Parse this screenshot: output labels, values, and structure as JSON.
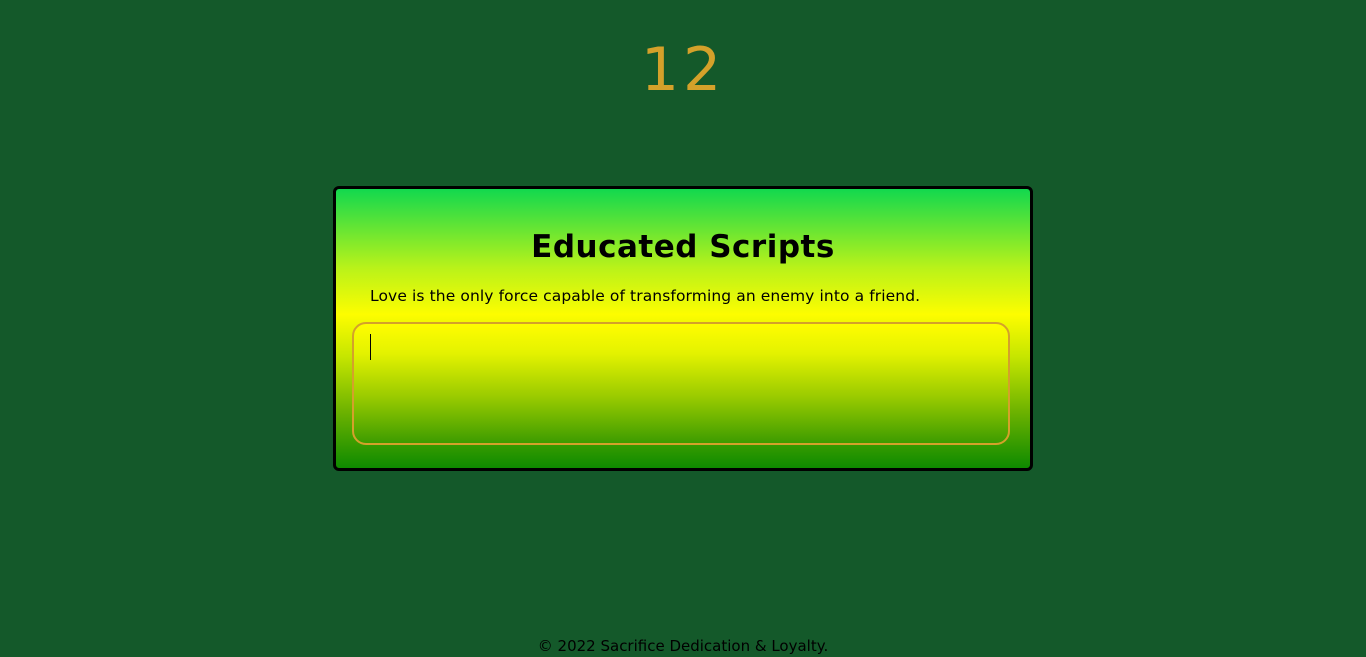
{
  "timer": {
    "seconds": "12"
  },
  "card": {
    "title": "Educated Scripts",
    "quote": "Love is the only force capable of transforming an enemy into a friend.",
    "input_value": ""
  },
  "footer": {
    "text": "© 2022 Sacrifice Dedication & Loyalty."
  },
  "colors": {
    "background": "#14592a",
    "timer": "#d4a12a",
    "input_border": "#d4a12a"
  }
}
